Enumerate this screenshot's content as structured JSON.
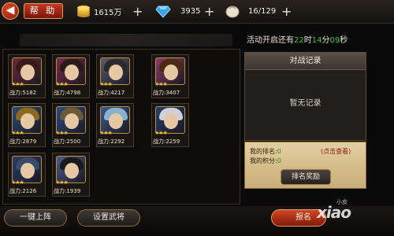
{
  "topbar": {
    "help_label": "帮 助",
    "gold": "1615万",
    "diamonds": "3935",
    "stamina": "16/129"
  },
  "timer": {
    "prefix": "活动开启还有",
    "hours": "22",
    "h_unit": "时",
    "minutes": "14",
    "m_unit": "分",
    "seconds": "09",
    "s_unit": "秒"
  },
  "heroes": [
    {
      "stars": "★★★",
      "power": "战力:5182",
      "hair": "#3a1a18",
      "bg": "#6a2a3a"
    },
    {
      "stars": "★★★",
      "power": "战力:4798",
      "hair": "#2a1a1a",
      "bg": "#7a2a4a"
    },
    {
      "stars": "★★★",
      "power": "战力:4217",
      "hair": "#2a2a2a",
      "bg": "#5a5a6a"
    },
    {
      "stars": "★★★",
      "power": "战力:3407",
      "hair": "#4a2a10",
      "bg": "#8a3a6a"
    },
    {
      "stars": "★★★",
      "power": "战力:2879",
      "hair": "#8a6a20",
      "bg": "#2a4a7a"
    },
    {
      "stars": "★★★",
      "power": "战力:2500",
      "hair": "#6a5a3a",
      "bg": "#2a4a8a"
    },
    {
      "stars": "★★★",
      "power": "战力:2292",
      "hair": "#8ab0d0",
      "bg": "#3a5a8a"
    },
    {
      "stars": "★★★",
      "power": "战力:2259",
      "hair": "#d0d0d8",
      "bg": "#2a3a6a"
    },
    {
      "stars": "★★★",
      "power": "战力:2126",
      "hair": "#3a4a6a",
      "bg": "#2a3a6a"
    },
    {
      "stars": "★★★",
      "power": "战力:1939",
      "hair": "#1a1a1a",
      "bg": "#4a5a8a"
    }
  ],
  "record": {
    "title": "对战记录",
    "empty": "暂无记录"
  },
  "rank": {
    "rank_label": "我的排名:",
    "rank_value": "0",
    "score_label": "我的积分:",
    "score_value": "0",
    "check_link": "(点击查看)",
    "reward_button": "排名奖励"
  },
  "bottom": {
    "one_click": "一键上阵",
    "set_hero": "设置武将",
    "signup": "报名"
  },
  "watermark": {
    "brand": "xiao",
    "small": "小皮"
  },
  "colors": {
    "accent_red": "#c2391f",
    "gold": "#f0b830",
    "timer_green": "#3ec23e"
  }
}
